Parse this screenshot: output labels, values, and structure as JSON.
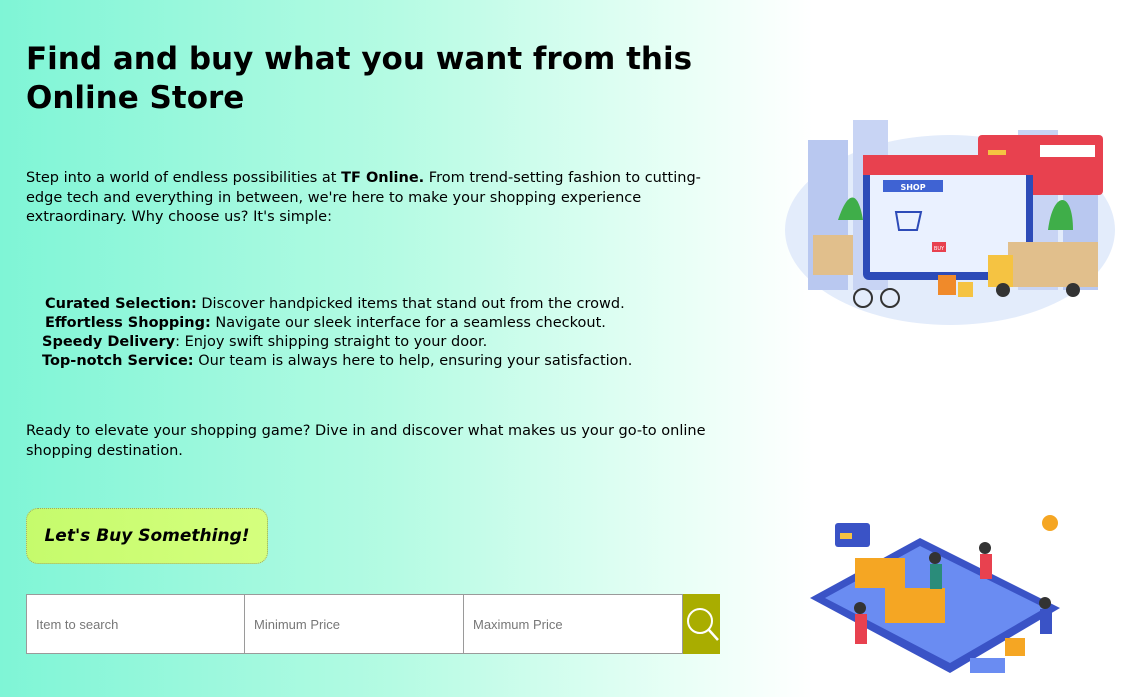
{
  "hero": {
    "title": "Find and buy what you want from this Online Store",
    "intro_before": "Step into a world of endless possibilities at ",
    "intro_brand": "TF Online.",
    "intro_after": " From trend-setting fashion to cutting-edge tech and everything in between, we're here to make your shopping experience extraordinary. Why choose us? It's simple:",
    "features": [
      {
        "title": "Curated Selection:",
        "text": " Discover handpicked items that stand out from the crowd."
      },
      {
        "title": "Effortless Shopping:",
        "text": " Navigate our sleek interface for a seamless checkout."
      },
      {
        "title": "Speedy Delivery",
        "text": ": Enjoy swift shipping straight to your door."
      },
      {
        "title": "Top-notch Service:",
        "text": " Our team is always here to help, ensuring your satisfaction."
      }
    ],
    "outro": "Ready to elevate your shopping game? Dive in and discover what makes us your go-to online shopping destination.",
    "cta_label": "Let's Buy Something!"
  },
  "search": {
    "item_placeholder": "Item to search",
    "min_placeholder": "Minimum Price",
    "max_placeholder": "Maximum Price",
    "button_color": "#a9ad00"
  },
  "illustrations": {
    "shop_sign": "SHOP",
    "buy_tag": "BUY"
  }
}
